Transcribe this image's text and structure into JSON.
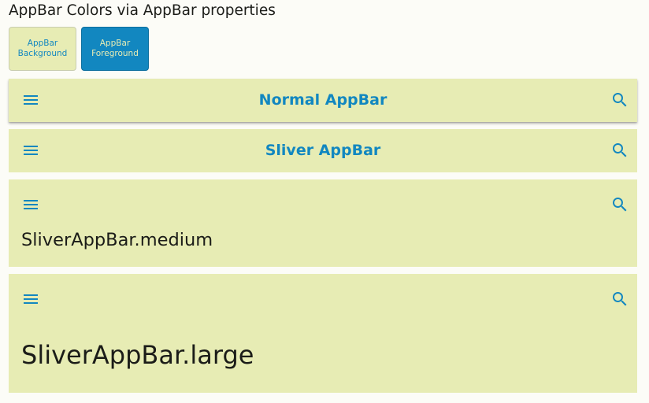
{
  "heading": "AppBar Colors via AppBar properties",
  "colors": {
    "appbar_background": "#e7ecb4",
    "appbar_foreground": "#1287c0",
    "page_background": "#fcfcf7",
    "text": "#1b1c18"
  },
  "swatches": {
    "background": {
      "line1": "AppBar",
      "line2": "Background"
    },
    "foreground": {
      "line1": "AppBar",
      "line2": "Foreground"
    }
  },
  "appbars": {
    "normal": {
      "title": "Normal AppBar",
      "leading_icon": "menu-icon",
      "action_icon": "search-icon"
    },
    "sliver": {
      "title": "Sliver AppBar",
      "leading_icon": "menu-icon",
      "action_icon": "search-icon"
    },
    "medium": {
      "title": "SliverAppBar.medium",
      "leading_icon": "menu-icon",
      "action_icon": "search-icon"
    },
    "large": {
      "title": "SliverAppBar.large",
      "leading_icon": "menu-icon",
      "action_icon": "search-icon"
    }
  }
}
